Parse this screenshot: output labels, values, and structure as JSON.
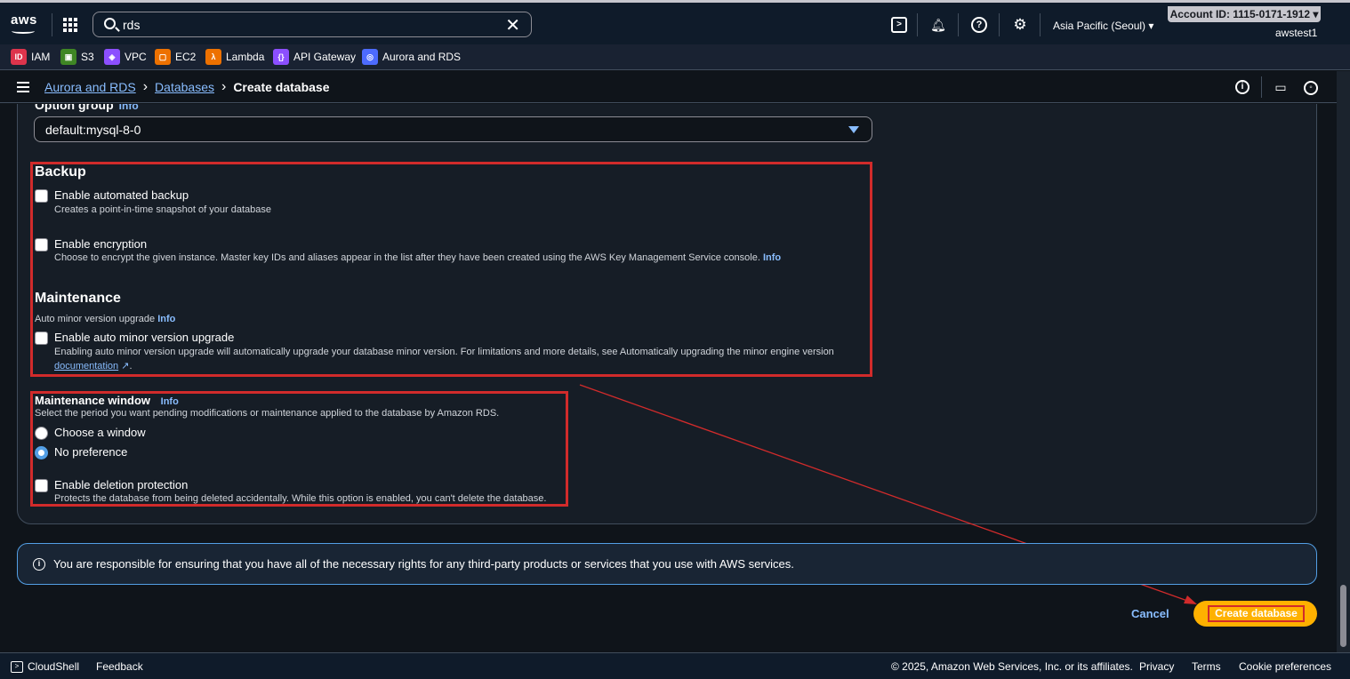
{
  "topbar": {
    "logo_text": "aws",
    "search_value": "rds",
    "region": "Asia Pacific (Seoul) ▾",
    "account": "Account ID: 1115-0171-1912 ▾",
    "user": "awstest1"
  },
  "favorites": [
    {
      "label": "IAM",
      "color": "#dd344c",
      "icon": "iam-icon"
    },
    {
      "label": "S3",
      "color": "#3f8624",
      "icon": "s3-icon"
    },
    {
      "label": "VPC",
      "color": "#8c4fff",
      "icon": "vpc-icon"
    },
    {
      "label": "EC2",
      "color": "#ed7100",
      "icon": "ec2-icon"
    },
    {
      "label": "Lambda",
      "color": "#ed7100",
      "icon": "lambda-icon"
    },
    {
      "label": "API Gateway",
      "color": "#8c4fff",
      "icon": "api-gateway-icon"
    },
    {
      "label": "Aurora and RDS",
      "color": "#4d6bfe",
      "icon": "rds-icon"
    }
  ],
  "breadcrumb": {
    "item1": "Aurora and RDS",
    "item2": "Databases",
    "current": "Create database"
  },
  "option_group": {
    "label": "Option group",
    "info": "Info",
    "value": "default:mysql-8-0"
  },
  "backup": {
    "title": "Backup",
    "automated_label": "Enable automated backup",
    "automated_desc": "Creates a point-in-time snapshot of your database",
    "encryption_label": "Enable encryption",
    "encryption_desc": "Choose to encrypt the given instance. Master key IDs and aliases appear in the list after they have been created using the AWS Key Management Service console.",
    "encryption_info": "Info"
  },
  "maintenance": {
    "title": "Maintenance",
    "auto_minor_caption": "Auto minor version upgrade",
    "auto_minor_info": "Info",
    "auto_minor_label": "Enable auto minor version upgrade",
    "auto_minor_desc": "Enabling auto minor version upgrade will automatically upgrade your database minor version. For limitations and more details, see Automatically upgrading the minor engine version",
    "doc_link": "documentation"
  },
  "maintenance_window": {
    "title": "Maintenance window",
    "info": "Info",
    "desc": "Select the period you want pending modifications or maintenance applied to the database by Amazon RDS.",
    "option1": "Choose a window",
    "option2": "No preference",
    "deletion_label": "Enable deletion protection",
    "deletion_desc": "Protects the database from being deleted accidentally. While this option is enabled, you can't delete the database."
  },
  "notice": "You are responsible for ensuring that you have all of the necessary rights for any third-party products or services that you use with AWS services.",
  "actions": {
    "cancel": "Cancel",
    "create": "Create database"
  },
  "footer": {
    "cloudshell": "CloudShell",
    "feedback": "Feedback",
    "copyright": "© 2025, Amazon Web Services, Inc. or its affiliates.",
    "privacy": "Privacy",
    "terms": "Terms",
    "cookies": "Cookie preferences"
  }
}
